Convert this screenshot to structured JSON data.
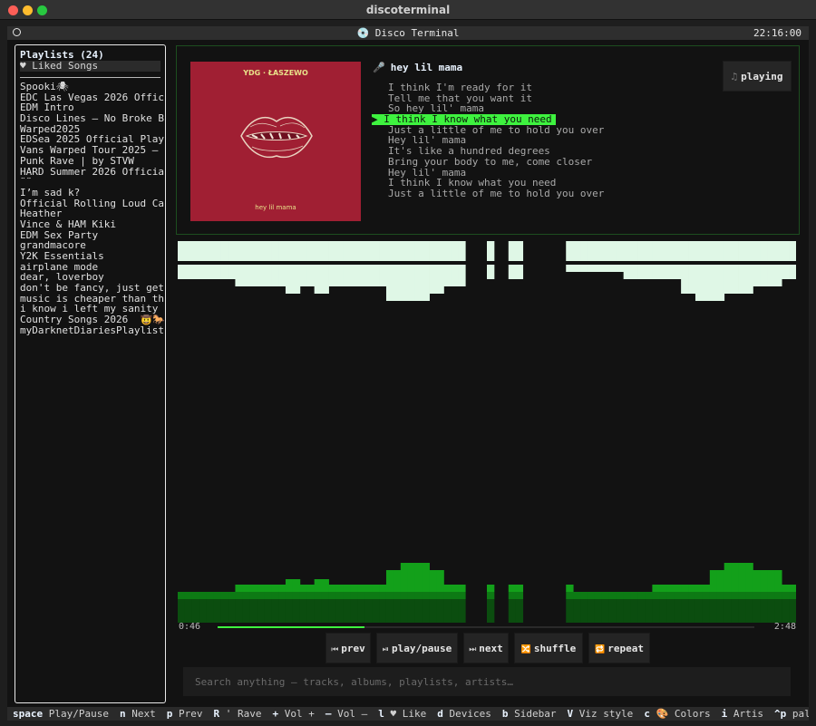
{
  "window": {
    "title": "discoterminal"
  },
  "header": {
    "title": "💿 Disco Terminal",
    "clock": "22:16:00"
  },
  "sidebar": {
    "title": "Playlists (24)",
    "liked": "♥ Liked Songs",
    "items": [
      "Spooki🕷",
      "EDC Las Vegas 2026 Offic",
      "EDM Intro",
      "Disco Lines – No Broke B",
      "Warped2025",
      "EDSea 2025 Official Play",
      "Vans Warped Tour 2025 –",
      "Punk Rave | by STVW",
      "HARD Summer 2026 Officia",
      "¨¨",
      "I’m sad k?",
      "Official Rolling Loud Ca",
      "Heather",
      "Vince & HAM Kiki",
      "EDM Sex Party",
      "grandmacore",
      "Y2K Essentials",
      "airplane mode",
      "dear, loverboy",
      "don't be fancy, just get",
      "music is cheaper than th",
      "i know i left my sanity",
      "Country Songs 2026  🤠🐎",
      "myDarknetDiariesPlaylist"
    ]
  },
  "now_playing": {
    "album_artist": "YDG · ŁASZEWO",
    "album_title": "hey lil mama",
    "mic_icon": "🎤",
    "track": "hey lil mama",
    "status": "playing",
    "status_icon": "♫",
    "lyrics": [
      "I think I'm ready for it",
      "Tell me that you want it",
      "So hey lil' mama",
      "▶ I think I know what you need",
      "Just a little of me to hold you over",
      "Hey lil' mama",
      "It's like a hundred degrees",
      "Bring your body to me, come closer",
      "Hey lil' mama",
      "I think I know what you need",
      "Just a little of me to hold you over"
    ],
    "current_lyric_index": 3
  },
  "colors": {
    "accent": "#3ef23f",
    "viz_top": "#dff7e6",
    "viz_bright": "#13a01a",
    "viz_mid": "#0d7a14",
    "viz_dark": "#0b4d0f",
    "album_bg": "#a01f33"
  },
  "visualizer": {
    "top_bands": [
      6,
      6,
      6,
      6,
      6,
      6,
      6,
      6,
      6,
      6,
      6,
      6,
      6,
      6,
      6,
      6,
      6,
      6,
      6,
      6,
      6,
      6,
      6,
      6,
      6,
      6,
      6,
      6,
      6,
      6,
      6,
      6,
      6,
      6,
      6,
      6,
      6,
      6,
      6,
      6,
      6,
      6,
      6,
      6,
      6,
      6,
      6,
      6,
      6,
      6,
      6,
      6,
      6,
      6,
      6,
      6,
      6,
      6,
      6,
      6,
      6,
      6,
      6,
      6,
      6,
      6,
      6,
      6,
      6,
      6,
      6,
      6,
      6,
      6,
      6,
      6,
      6,
      6,
      6,
      6,
      6,
      6,
      6,
      6,
      6,
      6
    ],
    "bottom_bands": [
      2,
      2,
      2,
      2,
      2,
      2,
      2,
      2,
      3,
      3,
      3,
      3,
      3,
      3,
      3,
      4,
      4,
      3,
      3,
      4,
      4,
      3,
      3,
      3,
      3,
      3,
      3,
      3,
      3,
      5,
      5,
      6,
      6,
      6,
      6,
      5,
      5,
      3,
      3,
      3,
      3,
      3,
      3,
      3,
      3,
      3,
      3,
      3,
      3,
      3,
      3,
      3,
      3,
      3,
      3,
      2,
      2,
      2,
      2,
      2,
      2,
      2,
      2,
      2,
      2,
      2,
      3,
      3,
      3,
      3,
      3,
      3,
      3,
      3,
      5,
      5,
      6,
      6,
      6,
      6,
      5,
      5,
      5,
      5,
      3,
      3
    ]
  },
  "progress": {
    "elapsed": "0:46",
    "total": "2:48",
    "fraction": 0.274
  },
  "controls": [
    {
      "icon": "⏮",
      "label": "prev"
    },
    {
      "icon": "⏯",
      "label": "play/pause"
    },
    {
      "icon": "⏭",
      "label": "next"
    },
    {
      "icon": "🔀",
      "label": "shuffle"
    },
    {
      "icon": "🔁",
      "label": "repeat"
    }
  ],
  "search": {
    "placeholder": "Search anything — tracks, albums, playlists, artists…"
  },
  "footer": [
    {
      "key": "space",
      "desc": "Play/Pause"
    },
    {
      "key": "n",
      "desc": "Next"
    },
    {
      "key": "p",
      "desc": "Prev"
    },
    {
      "key": "R",
      "desc": "' Rave"
    },
    {
      "key": "+",
      "desc": "Vol +"
    },
    {
      "key": "–",
      "desc": "Vol –"
    },
    {
      "key": "l",
      "desc": "♥ Like"
    },
    {
      "key": "d",
      "desc": "Devices"
    },
    {
      "key": "b",
      "desc": "Sidebar"
    },
    {
      "key": "V",
      "desc": "Viz style"
    },
    {
      "key": "c",
      "desc": "🎨 Colors"
    },
    {
      "key": "i",
      "desc": "Artis"
    },
    {
      "key": "^p",
      "desc": "palette"
    }
  ]
}
